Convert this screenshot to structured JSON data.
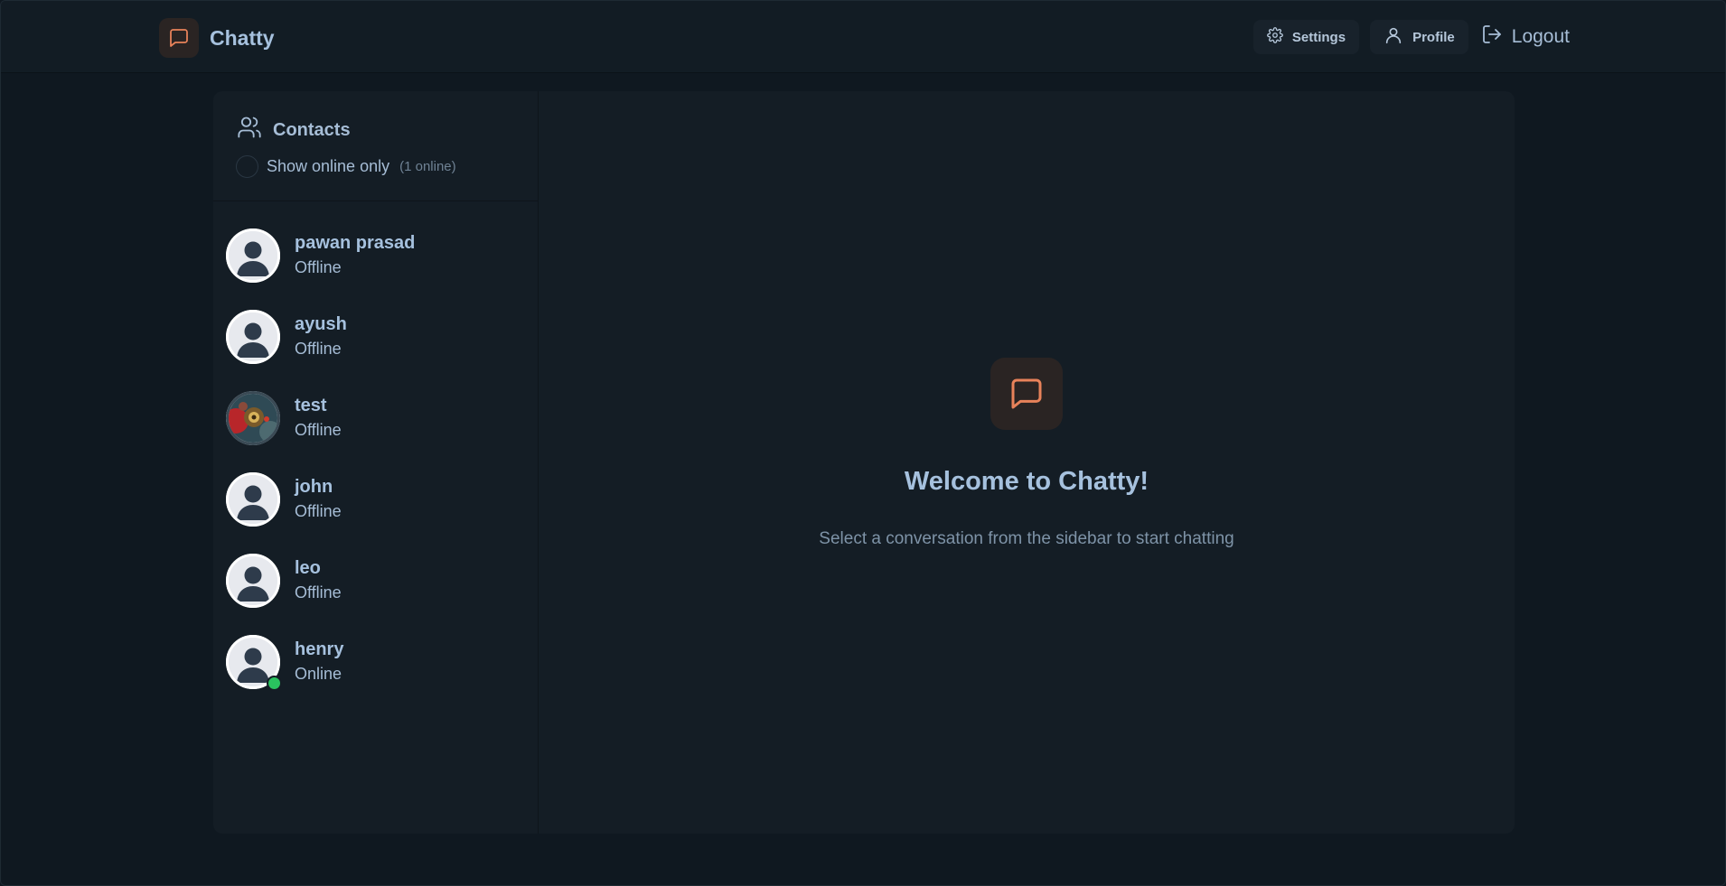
{
  "app": {
    "name": "Chatty"
  },
  "nav": {
    "settings_label": "Settings",
    "profile_label": "Profile",
    "logout_label": "Logout"
  },
  "sidebar": {
    "title": "Contacts",
    "filter_label": "Show online only",
    "online_count": "(1 online)",
    "contacts": [
      {
        "name": "pawan prasad",
        "status": "Offline",
        "avatar": "default-avatar",
        "online": false
      },
      {
        "name": "ayush",
        "status": "Offline",
        "avatar": "default-avatar",
        "online": false
      },
      {
        "name": "test",
        "status": "Offline",
        "avatar": "photo-avatar",
        "online": false
      },
      {
        "name": "john",
        "status": "Offline",
        "avatar": "default-avatar",
        "online": false
      },
      {
        "name": "leo",
        "status": "Offline",
        "avatar": "default-avatar",
        "online": false
      },
      {
        "name": "henry",
        "status": "Online",
        "avatar": "default-avatar",
        "online": true
      }
    ]
  },
  "welcome": {
    "title": "Welcome to Chatty!",
    "subtitle": "Select a conversation from the sidebar to start chatting"
  },
  "colors": {
    "accent": "#e8825a",
    "online": "#2ac25f",
    "background": "#0f1820",
    "panel": "#141d25"
  }
}
